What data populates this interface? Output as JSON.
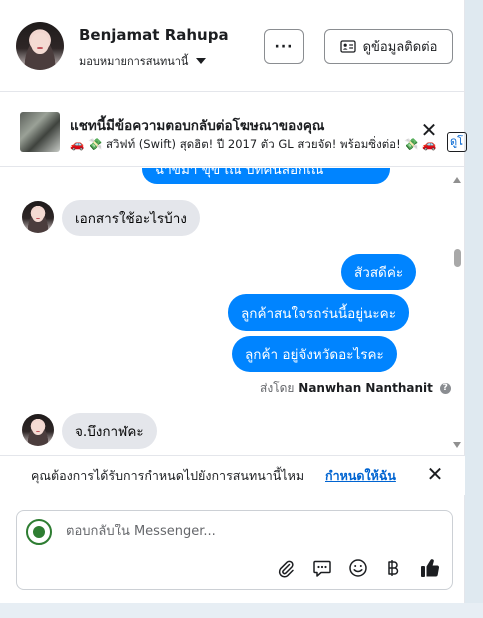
{
  "header": {
    "name": "Benjamat Rahupa",
    "assign_label": "มอบหมายการสนทนานี้",
    "more_label": "···",
    "contact_label": "ดูข้อมูลติดต่อ"
  },
  "ad_banner": {
    "title": "แชทนี้มีข้อความตอบกลับต่อโฆษณาของคุณ",
    "subtitle": "🚗 💸 สวิฟท์ (Swift) สุดฮิต! ปี 2017 ตัว GL สวยจัด! พร้อมซิ่งต่อ! 💸 🚗 ...",
    "close_label": "✕",
    "view_label": "ดูโ"
  },
  "messages": {
    "partial_top": "ฉาขมา ขุ้ข เณ บทคนลอกเณ",
    "in_1": "เอกสารใช้อะไรบ้าง",
    "out_1": "สัวสดีค่ะ",
    "out_2": "ลูกค้าสนใจรถร่นนี้อยู่นะคะ",
    "out_3": "ลูกค้า อยู่จังหวัดอะไรคะ",
    "sent_by_prefix": "ส่งโดย",
    "sent_by_name": "Nanwhan Nanthanit",
    "in_2": "จ.บึงกาฬคะ"
  },
  "assign_prompt": {
    "question": "คุณต้องการได้รับการกำหนดไปยังการสนทนานี้ไหม",
    "link": "กำหนดให้ฉัน",
    "close_label": "✕"
  },
  "composer": {
    "placeholder": "ตอบกลับใน Messenger..."
  },
  "colors": {
    "outgoing_bubble": "#0084ff",
    "incoming_bubble": "#e4e6eb",
    "link": "#0064d1",
    "like": "#1c1e21"
  },
  "icons": [
    "contact-card-icon",
    "caret-down-icon",
    "close-icon",
    "info-icon",
    "paperclip-icon",
    "saved-reply-icon",
    "emoji-icon",
    "baht-icon",
    "thumbs-up-icon",
    "scroll-up-icon",
    "scroll-down-icon"
  ]
}
